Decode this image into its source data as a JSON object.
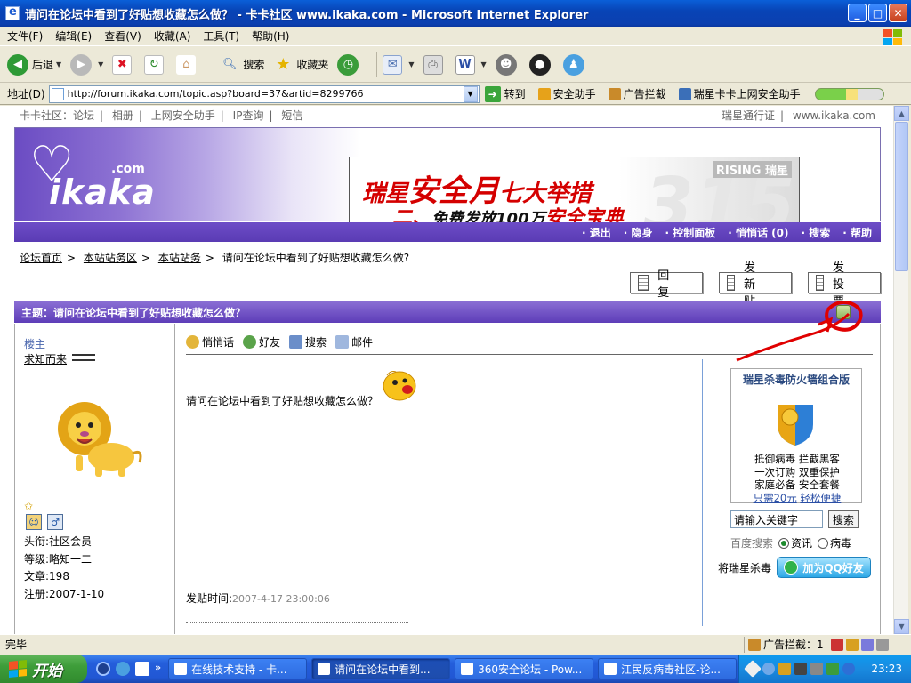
{
  "window": {
    "title": "请问在论坛中看到了好贴想收藏怎么做？ - 卡卡社区 www.ikaka.com - Microsoft Internet Explorer",
    "buttons": {
      "minimize": "_",
      "maximize": "□",
      "close": "✕"
    }
  },
  "menu": {
    "items": [
      "文件(F)",
      "编辑(E)",
      "查看(V)",
      "收藏(A)",
      "工具(T)",
      "帮助(H)"
    ]
  },
  "toolbar": {
    "back_label": "后退",
    "search_label": "搜索",
    "favorites_label": "收藏夹"
  },
  "address": {
    "label": "地址(D)",
    "url": "http://forum.ikaka.com/topic.asp?board=37&artid=8299766",
    "go_label": "转到",
    "tools": [
      "安全助手",
      "广告拦截",
      "瑞星卡卡上网安全助手"
    ]
  },
  "page": {
    "topnav_left": [
      "卡卡社区：论坛",
      "相册",
      "上网安全助手",
      "IP查询",
      "短信"
    ],
    "topnav_right": [
      "瑞星通行证",
      "www.ikaka.com"
    ],
    "logo": {
      "word": "ikaka",
      "suffix": ".com"
    },
    "banner": {
      "line1_a": "瑞星",
      "line1_b": "安全月",
      "line1_c": "七大举措",
      "line2_a": "二、",
      "line2_b": "免费发放100万",
      "line2_c": "安全宝典",
      "brand": "RISING 瑞星",
      "watermark": "315"
    },
    "navbar": [
      "· 退出",
      "· 隐身",
      "· 控制面板",
      "· 悄悄话 (0)",
      "· 搜索",
      "· 帮助"
    ],
    "breadcrumb": [
      "论坛首页",
      "本站站务区",
      "本站站务",
      "请问在论坛中看到了好贴想收藏怎么做?"
    ],
    "actions": {
      "reply": "回 复",
      "new_post": "发 新 贴",
      "vote": "发 投 票"
    },
    "topic_title": "主题：请问在论坛中看到了好贴想收藏怎么做？",
    "author": {
      "role": "楼主",
      "name": "求知而来",
      "badge_gender": "♂",
      "stats": [
        "头衔:社区会员",
        "等级:略知一二",
        "文章:198",
        "注册:2007-1-10"
      ]
    },
    "post_tools": [
      "悄悄话",
      "好友",
      "搜索",
      "邮件"
    ],
    "post_body": "请问在论坛中看到了好贴想收藏怎么做？",
    "post_time_label": "发贴时间:",
    "post_time_value": "2007-4-17 23:00:06",
    "ad": {
      "title": "瑞星杀毒防火墙组合版",
      "lines": [
        "抵御病毒  拦截黑客",
        "一次订购  双重保护",
        "家庭必备  安全套餐"
      ],
      "link_a": "只需20元",
      "link_b": "轻松便捷"
    },
    "keyword_placeholder": "请输入关键字",
    "search_button": "搜索",
    "baidu_label": "百度搜索",
    "radio_news": "资讯",
    "radio_virus": "病毒",
    "qq_prompt": "将瑞星杀毒",
    "qq_button": "加为QQ好友"
  },
  "status": {
    "text": "完毕",
    "adblock": "广告拦截：1"
  },
  "taskbar": {
    "start": "开始",
    "tasks": [
      "在线技术支持 - 卡...",
      "请问在论坛中看到...",
      "360安全论坛 - Pow...",
      "江民反病毒社区-论..."
    ],
    "clock": "23:23"
  },
  "colors": {
    "forum_purple": "#5d3db8",
    "xp_blue": "#245EDB",
    "annotation_red": "#e00000"
  }
}
